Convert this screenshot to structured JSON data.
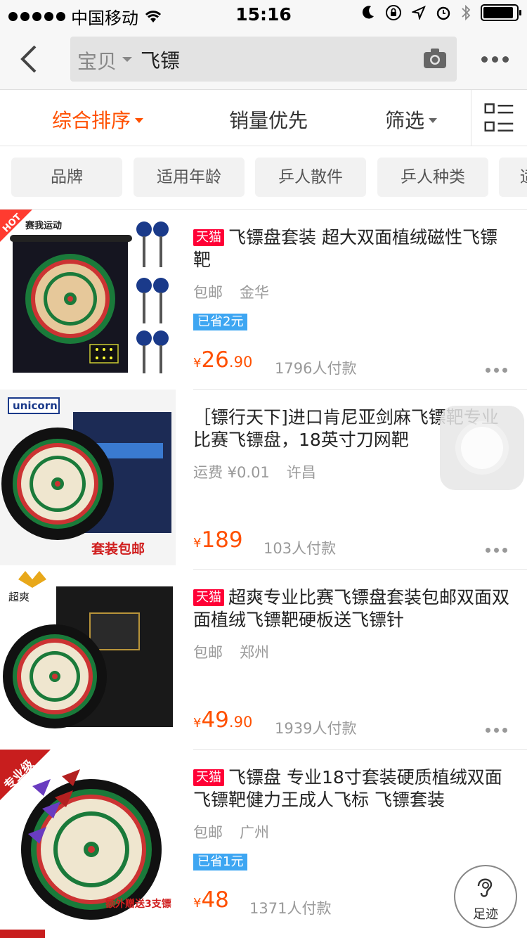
{
  "status_bar": {
    "carrier": "中国移动",
    "time": "15:16"
  },
  "nav": {
    "category": "宝贝",
    "query": "飞镖"
  },
  "sort_bar": {
    "comprehensive": "综合排序",
    "sales": "销量优先",
    "filter": "筛选"
  },
  "filter_chips": [
    "品牌",
    "适用年龄",
    "乒人散件",
    "乒人种类",
    "适"
  ],
  "products": [
    {
      "tmall": "天猫",
      "title": "飞镖盘套装 超大双面植绒磁性飞镖靶",
      "shipping": "包邮",
      "location": "金华",
      "saved": "已省2元",
      "currency": "¥",
      "price_int": "26",
      "price_dec": ".90",
      "sold": "1796人付款",
      "image_badge": "HOT",
      "image_brand": "赛我运动"
    },
    {
      "tmall": "",
      "title": "［镖行天下]进口肯尼亚剑麻飞镖靶专业比赛飞镖盘，18英寸刀网靶",
      "shipping": "运费 ¥0.01",
      "location": "许昌",
      "saved": "",
      "currency": "¥",
      "price_int": "189",
      "price_dec": "",
      "sold": "103人付款",
      "image_brand": "unicorn",
      "image_caption": "套装包邮"
    },
    {
      "tmall": "天猫",
      "title": "超爽专业比赛飞镖盘套装包邮双面双面植绒飞镖靶硬板送飞镖针",
      "shipping": "包邮",
      "location": "郑州",
      "saved": "",
      "currency": "¥",
      "price_int": "49",
      "price_dec": ".90",
      "sold": "1939人付款",
      "image_brand": "超爽"
    },
    {
      "tmall": "天猫",
      "title": "飞镖盘 专业18寸套装硬质植绒双面飞镖靶健力王成人飞标 飞镖套装",
      "shipping": "包邮",
      "location": "广州",
      "saved": "已省1元",
      "currency": "¥",
      "price_int": "48",
      "price_dec": "",
      "sold": "1371人付款",
      "image_badge": "专业级",
      "image_caption": "额外赠送3支镖"
    }
  ],
  "footprint": {
    "label": "足迹"
  },
  "colors": {
    "accent": "#ff5000",
    "tmall": "#ff0036",
    "saved": "#3ea6f2"
  }
}
